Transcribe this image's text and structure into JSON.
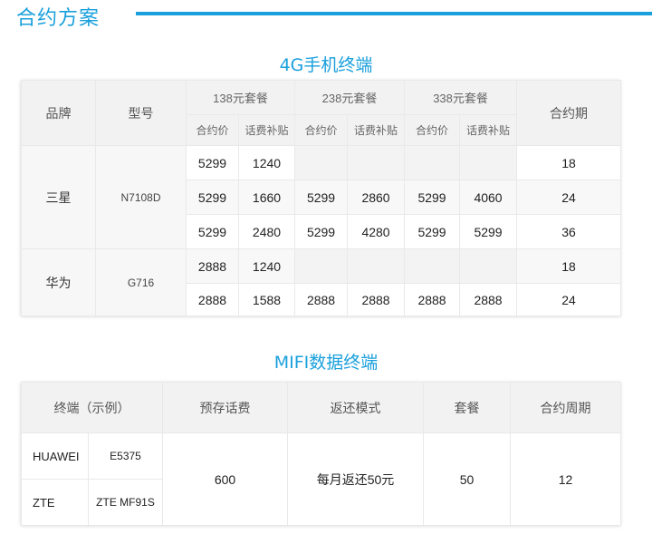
{
  "page_title": "合约方案",
  "section1": {
    "title": "4G手机终端",
    "headers": {
      "brand": "品牌",
      "model": "型号",
      "term": "合约期",
      "plans": [
        "138元套餐",
        "238元套餐",
        "338元套餐"
      ],
      "sub_price": "合约价",
      "sub_subsidy": "话费补贴"
    },
    "groups": [
      {
        "brand": "三星",
        "model": "N7108D",
        "rows": [
          {
            "cells": [
              "5299",
              "1240",
              "",
              "",
              "",
              ""
            ],
            "term": "18"
          },
          {
            "cells": [
              "5299",
              "1660",
              "5299",
              "2860",
              "5299",
              "4060"
            ],
            "term": "24"
          },
          {
            "cells": [
              "5299",
              "2480",
              "5299",
              "4280",
              "5299",
              "5299"
            ],
            "term": "36"
          }
        ]
      },
      {
        "brand": "华为",
        "model": "G716",
        "rows": [
          {
            "cells": [
              "2888",
              "1240",
              "",
              "",
              "",
              ""
            ],
            "term": "18"
          },
          {
            "cells": [
              "2888",
              "1588",
              "2888",
              "2888",
              "2888",
              "2888"
            ],
            "term": "24"
          }
        ]
      }
    ]
  },
  "section2": {
    "title": "MIFI数据终端",
    "headers": {
      "terminal": "终端（示例）",
      "deposit": "预存话费",
      "refund": "返还模式",
      "plan": "套餐",
      "term": "合约周期"
    },
    "devices": [
      {
        "brand": "HUAWEI",
        "model": "E5375"
      },
      {
        "brand": "ZTE",
        "model": "ZTE MF91S"
      }
    ],
    "deposit": "600",
    "refund": "每月返还50元",
    "plan": "50",
    "term": "12"
  }
}
